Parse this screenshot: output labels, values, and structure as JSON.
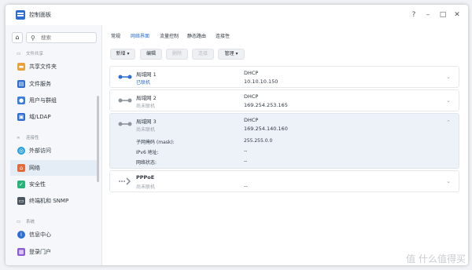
{
  "window": {
    "title": "控制面板",
    "help": "?",
    "minimize": "–",
    "maximize": "□",
    "close": "✕"
  },
  "sidebar": {
    "search_placeholder": "搜索",
    "sections": [
      {
        "label": "文件共享",
        "icon": "folder-icon"
      },
      {
        "label": "连接性",
        "icon": "link-icon"
      },
      {
        "label": "系统",
        "icon": "system-icon"
      }
    ],
    "items": [
      {
        "label": "共享文件夹",
        "icon": "shared-folder-icon",
        "color": "#e8a33d"
      },
      {
        "label": "文件服务",
        "icon": "file-service-icon",
        "color": "#2f6ed1"
      },
      {
        "label": "用户与群组",
        "icon": "users-icon",
        "color": "#3d7fd8"
      },
      {
        "label": "域/LDAP",
        "icon": "ldap-icon",
        "color": "#2f6ed1"
      },
      {
        "label": "外部访问",
        "icon": "external-access-icon",
        "color": "#2aa0dd"
      },
      {
        "label": "网络",
        "icon": "network-icon",
        "color": "#e36a3a"
      },
      {
        "label": "安全性",
        "icon": "security-icon",
        "color": "#27b47a"
      },
      {
        "label": "终端机和 SNMP",
        "icon": "terminal-icon",
        "color": "#4a5560"
      },
      {
        "label": "信息中心",
        "icon": "info-icon",
        "color": "#2f6ed1"
      },
      {
        "label": "登录门户",
        "icon": "portal-icon",
        "color": "#8d5bd6"
      }
    ],
    "selected": "网络"
  },
  "tabs": [
    {
      "label": "常规"
    },
    {
      "label": "网络界面",
      "active": true
    },
    {
      "label": "流量控制"
    },
    {
      "label": "静态路由"
    },
    {
      "label": "连接性"
    }
  ],
  "toolbar": {
    "add": "新增 ▾",
    "edit": "编辑",
    "delete": "删除",
    "connect": "连接",
    "manage": "管理 ▾"
  },
  "interfaces": [
    {
      "name": "局域网 1",
      "status": "已联机",
      "connected": true,
      "mode": "DHCP",
      "ip": "10.10.10.150",
      "expanded": false
    },
    {
      "name": "局域网 2",
      "status": "尚未联机",
      "connected": false,
      "mode": "DHCP",
      "ip": "169.254.253.165",
      "expanded": false
    },
    {
      "name": "局域网 3",
      "status": "尚未联机",
      "connected": false,
      "mode": "DHCP",
      "ip": "169.254.140.160",
      "expanded": true,
      "details": [
        {
          "label": "子网掩码 (mask):",
          "value": "255.255.0.0"
        },
        {
          "label": "IPv6 地址:",
          "value": "--"
        },
        {
          "label": "网络状态:",
          "value": "--"
        }
      ]
    },
    {
      "name": "PPPoE",
      "status": "尚未联机",
      "connected": false,
      "mode": "",
      "ip": "--",
      "expanded": false
    }
  ],
  "watermark": "值 什么值得买",
  "colors": {
    "accent": "#2d6dd4",
    "selected_bg": "#e4ecf5",
    "expanded_bg": "#edf2f8"
  }
}
